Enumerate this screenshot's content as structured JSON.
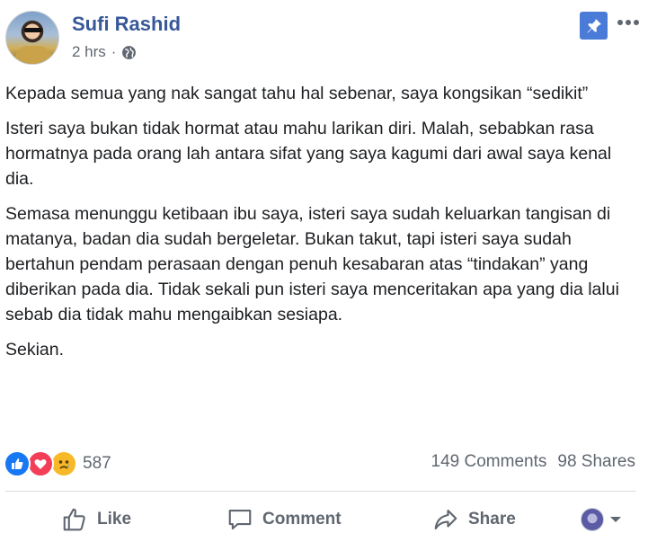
{
  "post": {
    "author": "Sufi Rashid",
    "time": "2 hrs",
    "separator": "·",
    "paragraphs": [
      "Kepada semua yang nak sangat tahu hal sebenar, saya kongsikan “sedikit”",
      "Isteri saya bukan tidak hormat atau mahu larikan diri. Malah, sebabkan rasa hormatnya pada orang lah antara sifat yang saya kagumi dari awal saya kenal dia.",
      "Semasa menunggu ketibaan ibu saya, isteri saya sudah keluarkan tangisan di matanya, badan dia sudah bergeletar. Bukan takut, tapi isteri saya sudah bertahun pendam perasaan dengan penuh kesabaran atas “tindakan” yang diberikan pada dia. Tidak sekali pun isteri saya menceritakan apa yang dia lalui sebab dia tidak mahu mengaibkan sesiapa.",
      "Sekian."
    ]
  },
  "reactions": {
    "count": "587",
    "icons": [
      "like-reaction-icon",
      "love-reaction-icon",
      "sad-reaction-icon"
    ]
  },
  "stats": {
    "comments": "149 Comments",
    "shares": "98 Shares"
  },
  "actions": {
    "like": "Like",
    "comment": "Comment",
    "share": "Share"
  },
  "colors": {
    "author": "#385898",
    "pin_button": "#4a7bd6",
    "like": "#1877f2",
    "love": "#f33e58",
    "sad": "#f7b928",
    "muted": "#606770"
  }
}
